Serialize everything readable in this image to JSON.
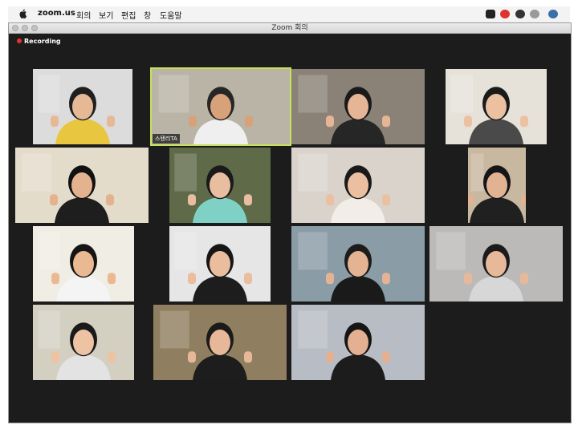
{
  "menubar": {
    "app_name": "zoom.us",
    "items": [
      "회의",
      "보기",
      "편집",
      "창",
      "도움말"
    ]
  },
  "window": {
    "title": "Zoom 회의"
  },
  "recording": {
    "label": "Recording"
  },
  "participants": [
    {
      "name": "",
      "bg": "#dcdcdc",
      "shirt": "#e8c640",
      "hair": "#1f1f1f",
      "skin": "#e6b996"
    },
    {
      "name": "스탠리TA",
      "bg": "#b9b4a5",
      "shirt": "#efefef",
      "hair": "#262626",
      "skin": "#d7a17a",
      "active": true
    },
    {
      "name": "",
      "bg": "#8a8276",
      "shirt": "#262626",
      "hair": "#1a1a1a",
      "skin": "#e6b595"
    },
    {
      "name": "",
      "bg": "#e6e2da",
      "shirt": "#4a4a4a",
      "hair": "#1a1a1a",
      "skin": "#ebc1a2"
    },
    {
      "name": "",
      "bg": "#e4dccb",
      "shirt": "#1e1e1e",
      "hair": "#111111",
      "skin": "#e3b28f"
    },
    {
      "name": "",
      "bg": "#5e6a48",
      "shirt": "#7fd1c5",
      "hair": "#1a1a1a",
      "skin": "#e8bda0"
    },
    {
      "name": "",
      "bg": "#d9d3cc",
      "shirt": "#f2ede6",
      "hair": "#1a1a1a",
      "skin": "#ebc0a0"
    },
    {
      "name": "",
      "bg": "#c9b8a0",
      "shirt": "#202020",
      "hair": "#161616",
      "skin": "#e2b393"
    },
    {
      "name": "",
      "bg": "#f0ede4",
      "shirt": "#f4f4f4",
      "hair": "#151515",
      "skin": "#eab991"
    },
    {
      "name": "",
      "bg": "#e6e6e6",
      "shirt": "#1d1d1d",
      "hair": "#161616",
      "skin": "#e9bd9d"
    },
    {
      "name": "",
      "bg": "#8a9ca6",
      "shirt": "#1a1a1a",
      "hair": "#1c1c1c",
      "skin": "#e4b394"
    },
    {
      "name": "",
      "bg": "#bcbab8",
      "shirt": "#d7d7d7",
      "hair": "#1b1b1b",
      "skin": "#e7b99a"
    },
    {
      "name": "",
      "bg": "#d3d0c2",
      "shirt": "#e3e3e3",
      "hair": "#1a1a1a",
      "skin": "#edc3a4"
    },
    {
      "name": "",
      "bg": "#8f7f60",
      "shirt": "#1d1d1d",
      "hair": "#1a1a1a",
      "skin": "#e6b798"
    },
    {
      "name": "",
      "bg": "#b8bcc4",
      "shirt": "#1c1c1c",
      "hair": "#151515",
      "skin": "#e3b192"
    }
  ]
}
